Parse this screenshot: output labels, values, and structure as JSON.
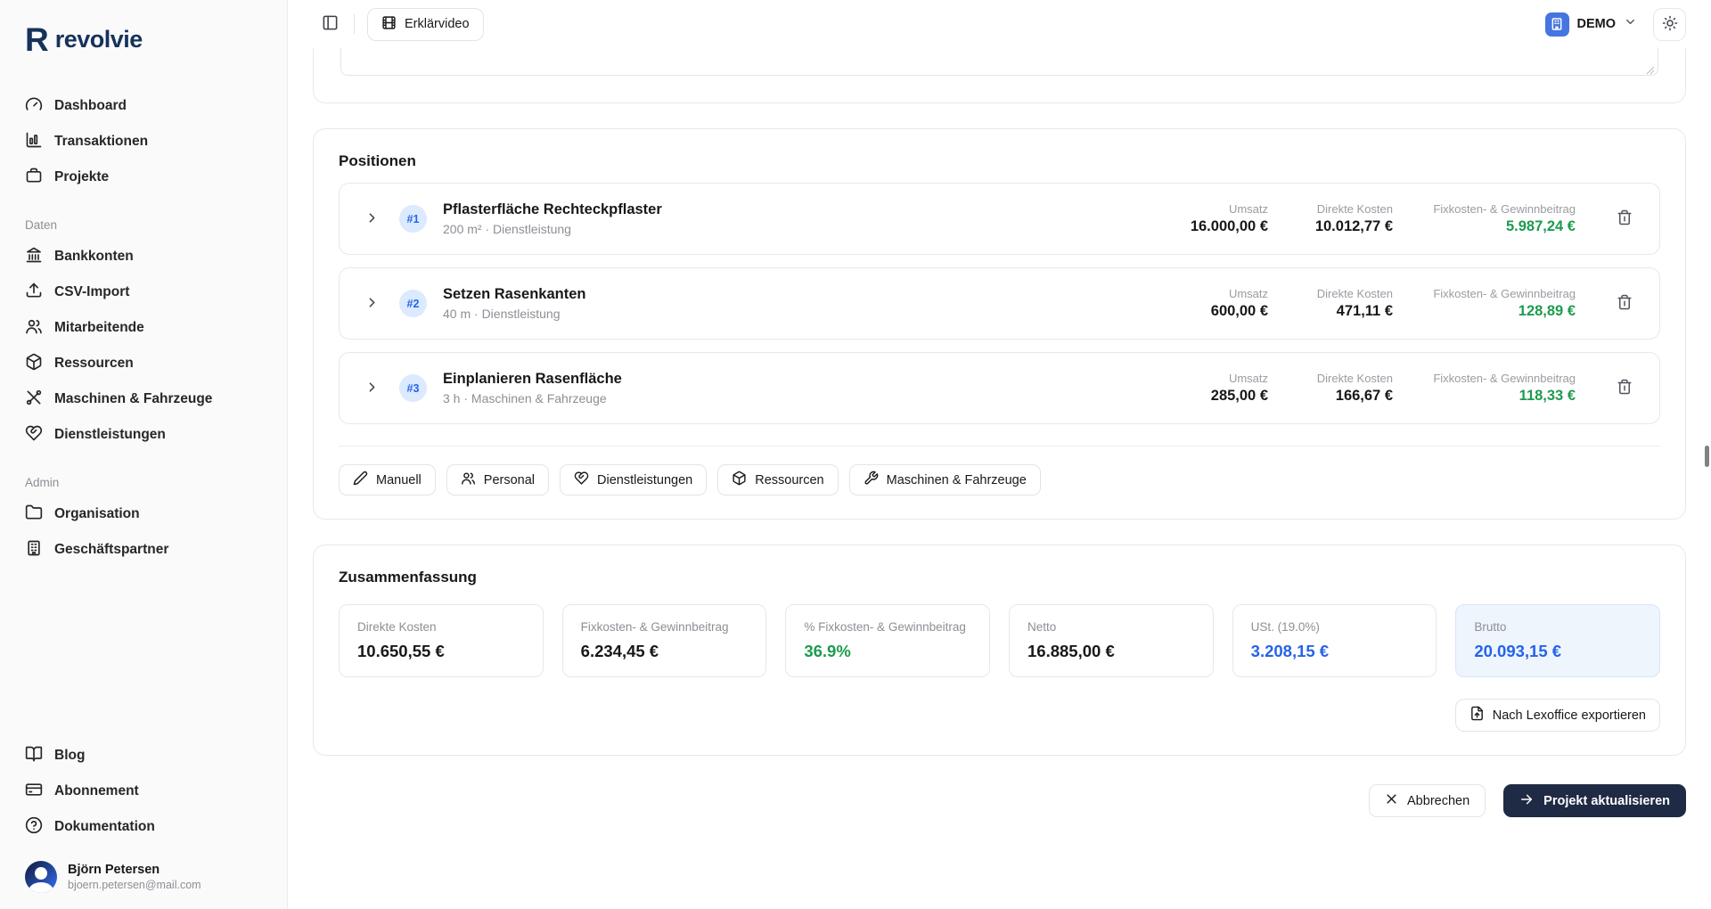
{
  "brand": {
    "name": "revolvie"
  },
  "topbar": {
    "help_video_label": "Erklärvideo",
    "org": {
      "name": "DEMO"
    }
  },
  "sidebar": {
    "main_items": [
      {
        "label": "Dashboard"
      },
      {
        "label": "Transaktionen"
      },
      {
        "label": "Projekte"
      }
    ],
    "sections": [
      {
        "title": "Daten",
        "items": [
          {
            "label": "Bankkonten"
          },
          {
            "label": "CSV-Import"
          },
          {
            "label": "Mitarbeitende"
          },
          {
            "label": "Ressourcen"
          },
          {
            "label": "Maschinen & Fahrzeuge"
          },
          {
            "label": "Dienstleistungen"
          }
        ]
      },
      {
        "title": "Admin",
        "items": [
          {
            "label": "Organisation"
          },
          {
            "label": "Geschäftspartner"
          }
        ]
      }
    ],
    "footer_items": [
      {
        "label": "Blog"
      },
      {
        "label": "Abonnement"
      },
      {
        "label": "Dokumentation"
      }
    ],
    "user": {
      "name": "Björn Petersen",
      "email": "bjoern.petersen@mail.com"
    }
  },
  "positions": {
    "title": "Positionen",
    "columns": {
      "umsatz": "Umsatz",
      "direkte_kosten": "Direkte Kosten",
      "fixkosten": "Fixkosten- & Gewinnbeitrag"
    },
    "items": [
      {
        "number": "#1",
        "title": "Pflasterfläche Rechteckpflaster",
        "subtitle": "200 m² · Dienstleistung",
        "umsatz": "16.000,00 €",
        "direkte_kosten": "10.012,77 €",
        "fixkosten": "5.987,24 €"
      },
      {
        "number": "#2",
        "title": "Setzen Rasenkanten",
        "subtitle": "40 m · Dienstleistung",
        "umsatz": "600,00 €",
        "direkte_kosten": "471,11 €",
        "fixkosten": "128,89 €"
      },
      {
        "number": "#3",
        "title": "Einplanieren Rasenfläche",
        "subtitle": "3 h · Maschinen & Fahrzeuge",
        "umsatz": "285,00 €",
        "direkte_kosten": "166,67 €",
        "fixkosten": "118,33 €"
      }
    ],
    "add_buttons": [
      {
        "label": "Manuell"
      },
      {
        "label": "Personal"
      },
      {
        "label": "Dienstleistungen"
      },
      {
        "label": "Ressourcen"
      },
      {
        "label": "Maschinen & Fahrzeuge"
      }
    ]
  },
  "summary": {
    "title": "Zusammenfassung",
    "cards": [
      {
        "label": "Direkte Kosten",
        "value": "10.650,55 €"
      },
      {
        "label": "Fixkosten- & Gewinnbeitrag",
        "value": "6.234,45 €"
      },
      {
        "label": "% Fixkosten- & Gewinnbeitrag",
        "value": "36.9%"
      },
      {
        "label": "Netto",
        "value": "16.885,00 €"
      },
      {
        "label": "USt. (19.0%)",
        "value": "3.208,15 €"
      },
      {
        "label": "Brutto",
        "value": "20.093,15 €"
      }
    ],
    "export_label": "Nach Lexoffice exportieren"
  },
  "footer_actions": {
    "cancel": "Abbrechen",
    "submit": "Projekt aktualisieren"
  },
  "colors": {
    "brand_navy": "#16325c",
    "primary_button": "#1f2a44",
    "accent_blue": "#2563eb",
    "positive_green": "#1d9b4e",
    "badge_bg": "#dbeafe",
    "highlight_card_bg": "#eef5fd",
    "border": "#e8e8ec",
    "sidebar_bg": "#fafafa"
  }
}
